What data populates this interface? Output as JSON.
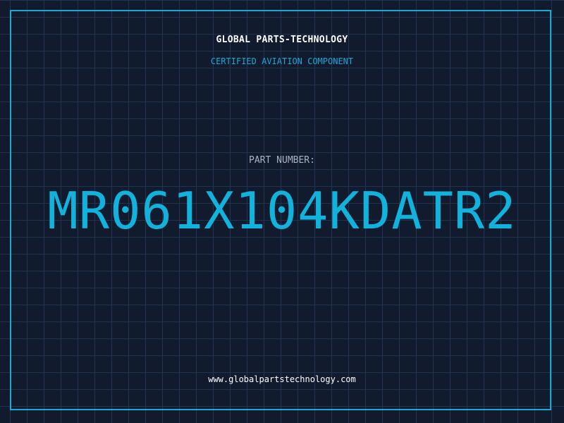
{
  "company": "GLOBAL PARTS-TECHNOLOGY",
  "subtitle": "CERTIFIED AVIATION COMPONENT",
  "part": {
    "label": "PART NUMBER:",
    "number": "MR061X104KDATR2"
  },
  "website": "www.globalpartstechnology.com",
  "colors": {
    "background": "#121a2e",
    "grid": "#1e3450",
    "accent": "#1aa8d4",
    "part_number": "#11b3dd"
  }
}
